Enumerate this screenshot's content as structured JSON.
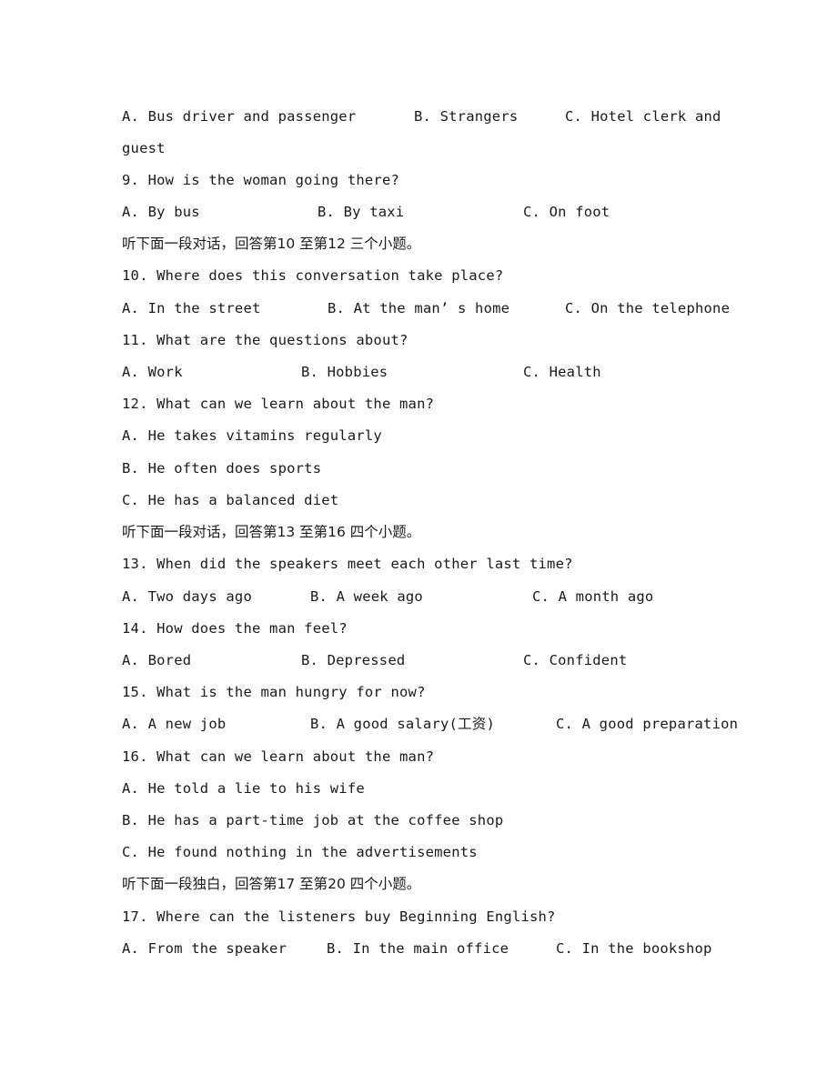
{
  "items": {
    "q8_options": {
      "a": "A. Bus driver and passenger",
      "b": "B. Strangers",
      "c": "C. Hotel clerk and",
      "c_wrap": "guest"
    },
    "q9": {
      "question": "9. How is the woman going there?",
      "a": "A. By bus",
      "b": "B. By taxi",
      "c": "C. On foot"
    },
    "section_10_12": "听下面一段对话，回答第10 至第12 三个小题。",
    "q10": {
      "question": "10. Where does this conversation take place?",
      "a": "A. In the street",
      "b": "B. At the man’ s home",
      "c": "C. On the telephone"
    },
    "q11": {
      "question": "11. What are the questions about?",
      "a": "A. Work",
      "b": "B. Hobbies",
      "c": "C. Health"
    },
    "q12": {
      "question": "12. What can we learn about the man?",
      "a": "A. He takes vitamins regularly",
      "b": "B. He often does sports",
      "c": "C. He has a balanced diet"
    },
    "section_13_16": "听下面一段对话，回答第13 至第16 四个小题。",
    "q13": {
      "question": "13. When did the speakers meet each other last time?",
      "a": "A. Two days ago",
      "b": "B. A week ago",
      "c": "C. A month ago"
    },
    "q14": {
      "question": "14. How does the man feel?",
      "a": "A. Bored",
      "b": "B. Depressed",
      "c": "C. Confident"
    },
    "q15": {
      "question": "15. What is the man hungry for now?",
      "a": "A. A new job",
      "b": "B. A good salary(工资)",
      "c": "C. A good preparation"
    },
    "q16": {
      "question": "16. What can we learn about the man?",
      "a": "A. He told a lie to his wife",
      "b": "B. He has a part-time job at the coffee shop",
      "c": "C. He found nothing in the advertisements"
    },
    "section_17_20": "听下面一段独白，回答第17 至第20 四个小题。",
    "q17": {
      "question": "17. Where can the listeners buy Beginning English?",
      "a": "A. From the speaker",
      "b": "B. In the main office",
      "c": "C. In the bookshop"
    }
  }
}
